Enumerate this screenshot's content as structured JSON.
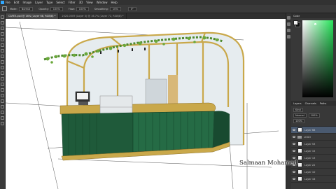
{
  "menubar": {
    "items": [
      "File",
      "Edit",
      "Image",
      "Layer",
      "Type",
      "Select",
      "Filter",
      "3D",
      "View",
      "Window",
      "Help"
    ]
  },
  "options_bar": {
    "mode_label": "Mode:",
    "mode_value": "Normal",
    "opacity_label": "Opacity:",
    "opacity_value": "100%",
    "flow_label": "Flow:",
    "flow_value": "100%",
    "smoothing_label": "Smoothing:",
    "smoothing_value": "10%",
    "angle_value": "0°"
  },
  "tabs": [
    {
      "label": "CAFE3.psd @ 16% (Layer 68, RGB/8) *",
      "active": true
    },
    {
      "label": "2020-0509 (Layer 0) @ 16.7% (Layer 72, RGB/8) *",
      "active": false
    }
  ],
  "panels": {
    "color_tab": "Color",
    "layers_tabs": [
      "Layers",
      "Channels",
      "Paths"
    ],
    "kind_label": "Kind",
    "blend_mode": "Normal",
    "opacity_value": "100%",
    "fill_value": "100%",
    "layers": [
      {
        "name": "Layer 68",
        "selected": true,
        "type": "layer"
      },
      {
        "name": "LOGO",
        "selected": false,
        "type": "folder"
      },
      {
        "name": "Layer 53",
        "selected": false,
        "type": "layer"
      },
      {
        "name": "Layer 15",
        "selected": false,
        "type": "layer"
      },
      {
        "name": "Layer 13",
        "selected": false,
        "type": "layer"
      },
      {
        "name": "Layer 22",
        "selected": false,
        "type": "layer"
      },
      {
        "name": "Layer 10",
        "selected": false,
        "type": "layer"
      },
      {
        "name": "Layer 16",
        "selected": false,
        "type": "layer"
      }
    ]
  },
  "colors": {
    "accent": "#31a8ff",
    "selected_layer": "#4a5a70",
    "tile_green": "#1f5a3a",
    "frame_gold": "#c9a84a",
    "picker_hue": "#27e35a"
  },
  "watermark": "Salmaan Mohamed"
}
